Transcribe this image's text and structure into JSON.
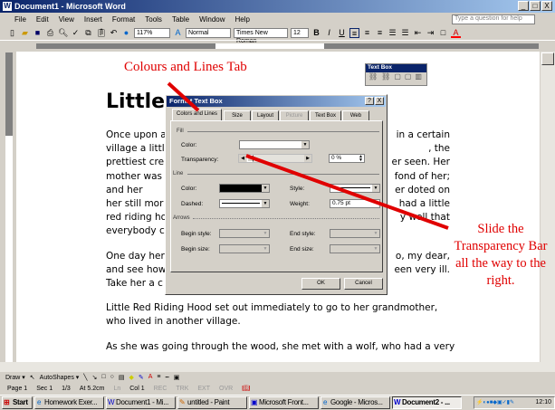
{
  "window": {
    "title": "Document1 - Microsoft Word",
    "min": "_",
    "max": "□",
    "close": "X"
  },
  "menu": [
    "File",
    "Edit",
    "View",
    "Insert",
    "Format",
    "Tools",
    "Table",
    "Window",
    "Help"
  ],
  "help_placeholder": "Type a question for help",
  "toolbar": {
    "zoom": "117%",
    "style": "Normal",
    "font": "Times New Roman",
    "size": "12",
    "bold": "B",
    "italic": "I",
    "underline": "U"
  },
  "document": {
    "heading": "Little",
    "paragraphs": [
      [
        "Once upon a",
        "in a certain"
      ],
      [
        "village a littl",
        ", the"
      ],
      [
        "prettiest cre",
        "er seen. Her"
      ],
      [
        "mother was",
        "fond of her;"
      ],
      [
        "and her",
        "er doted on"
      ],
      [
        "her still mor",
        "had a little"
      ],
      [
        "red riding ho",
        "y well that"
      ],
      [
        "everybody c",
        ""
      ]
    ],
    "para2": [
      [
        "One day her",
        "o, my dear,"
      ],
      [
        "and see how",
        "een very ill."
      ],
      [
        "Take her a c",
        ""
      ]
    ],
    "para3": "Little Red Riding Hood set out immediately to go to her grandmother, who lived in another village.",
    "para4": "As she was going through the wood, she met with a wolf, who had a very"
  },
  "annotations": {
    "tab_note": "Colours and Lines Tab",
    "slide_note": "Slide the Transparency Bar all the way to the right."
  },
  "textbox_toolbar": {
    "title": "Text Box"
  },
  "dialog": {
    "title": "Format Text Box",
    "help": "?",
    "close": "X",
    "tabs": [
      "Colors and Lines",
      "Size",
      "Layout",
      "Picture",
      "Text Box",
      "Web"
    ],
    "fill": {
      "section": "Fill",
      "color_label": "Color:",
      "transparency_label": "Transparency:",
      "transparency_value": "0 %",
      "transparency_fraction": 0
    },
    "line": {
      "section": "Line",
      "color_label": "Color:",
      "dashed_label": "Dashed:",
      "style_label": "Style:",
      "weight_label": "Weight:",
      "weight_value": "0.75 pt"
    },
    "arrows": {
      "section": "Arrows",
      "begin_style": "Begin style:",
      "begin_size": "Begin size:",
      "end_style": "End style:",
      "end_size": "End size:"
    },
    "ok": "OK",
    "cancel": "Cancel"
  },
  "drawbar": {
    "draw": "Draw ▾",
    "autoshapes": "AutoShapes ▾"
  },
  "status": {
    "page": "Page 1",
    "sec": "Sec 1",
    "pages": "1/3",
    "at": "At 5.2cm",
    "ln": "Ln",
    "col": "Col 1",
    "rec": "REC",
    "trk": "TRK",
    "ext": "EXT",
    "ovr": "OVR"
  },
  "taskbar": {
    "start": "Start",
    "tasks": [
      "Homework Exer...",
      "Document1 - Mi...",
      "untitled - Paint",
      "Microsoft Front...",
      "Google - Micros...",
      "Document2 - ..."
    ],
    "clock": "12:10"
  },
  "colors": {
    "annotation": "#e00000",
    "title_start": "#0a246a",
    "title_end": "#a6caf0"
  }
}
